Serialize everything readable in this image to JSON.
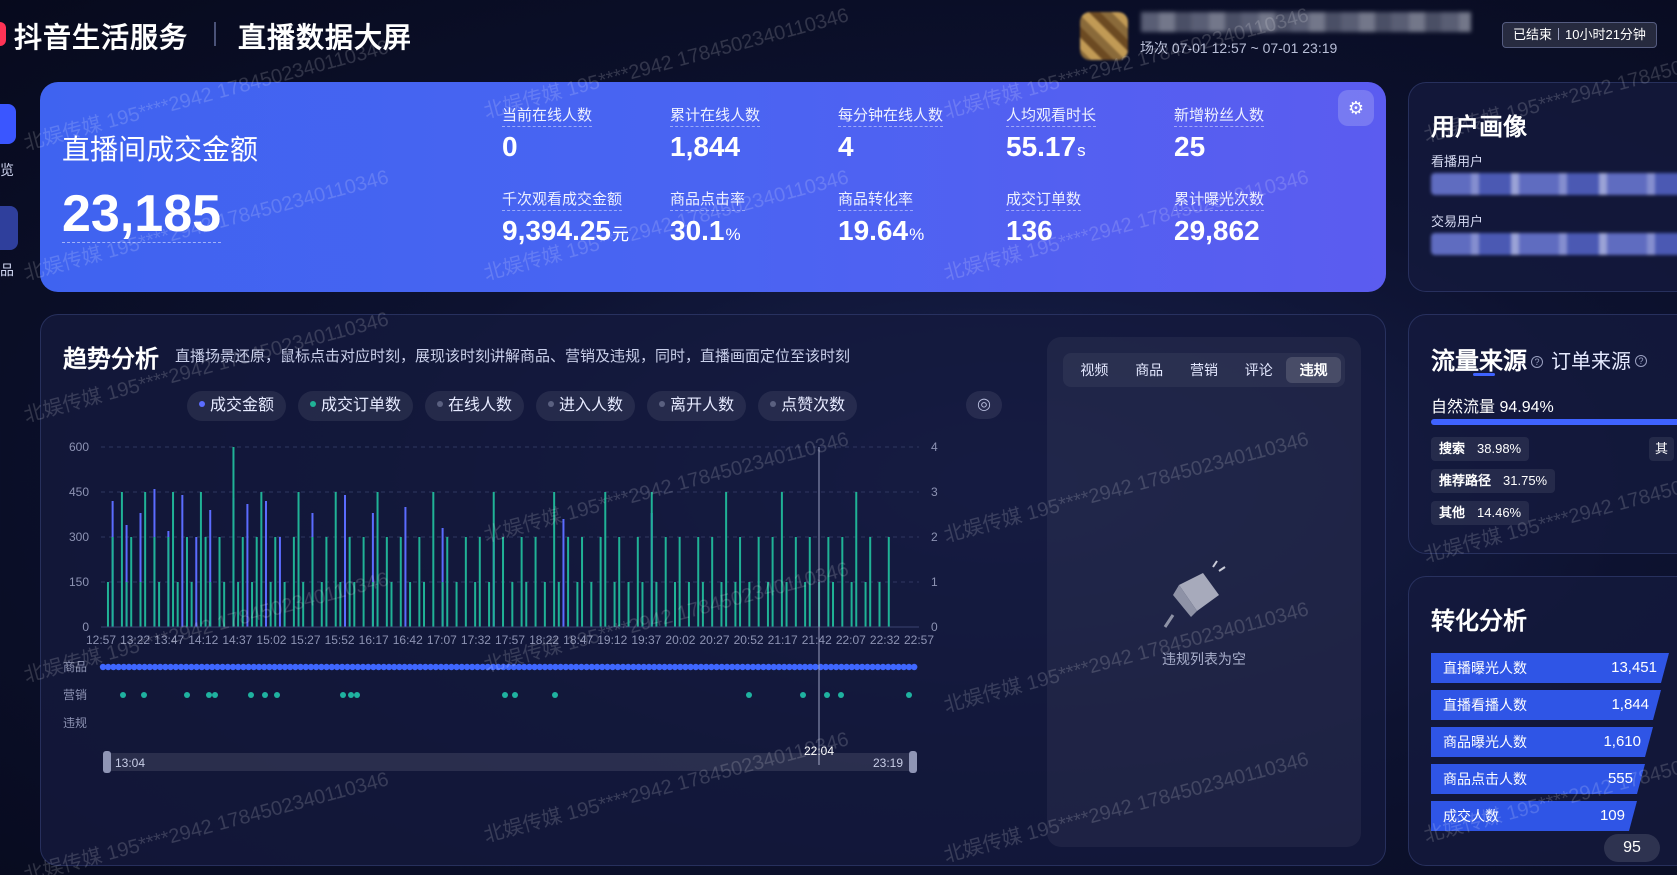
{
  "header": {
    "brand": "抖音生活服务",
    "screen_title": "直播数据大屏",
    "session": "场次 07-01 12:57 ~ 07-01 23:19",
    "status": "已结束",
    "duration": "10小时21分钟"
  },
  "left_nav": {
    "item1_label": "览",
    "item2_label": "品"
  },
  "kpi": {
    "title": "直播间成交金额",
    "value": "23,185",
    "metrics": [
      {
        "label": "当前在线人数",
        "value": "0",
        "unit": ""
      },
      {
        "label": "累计在线人数",
        "value": "1,844",
        "unit": ""
      },
      {
        "label": "每分钟在线人数",
        "value": "4",
        "unit": ""
      },
      {
        "label": "人均观看时长",
        "value": "55.17",
        "unit": "s"
      },
      {
        "label": "新增粉丝人数",
        "value": "25",
        "unit": ""
      },
      {
        "label": "千次观看成交金额",
        "value": "9,394.25",
        "unit": "元"
      },
      {
        "label": "商品点击率",
        "value": "30.1",
        "unit": "%"
      },
      {
        "label": "商品转化率",
        "value": "19.64",
        "unit": "%"
      },
      {
        "label": "成交订单数",
        "value": "136",
        "unit": ""
      },
      {
        "label": "累计曝光次数",
        "value": "29,862",
        "unit": ""
      }
    ]
  },
  "trend": {
    "title": "趋势分析",
    "subtitle": "直播场景还原，鼠标点击对应时刻，展现该时刻讲解商品、营销及违规，同时，直播画面定位至该时刻",
    "legend": [
      {
        "label": "成交金额",
        "color": "#5b6cff"
      },
      {
        "label": "成交订单数",
        "color": "#20b296"
      },
      {
        "label": "在线人数",
        "color": "#5a6080"
      },
      {
        "label": "进入人数",
        "color": "#5a6080"
      },
      {
        "label": "离开人数",
        "color": "#5a6080"
      },
      {
        "label": "点赞次数",
        "color": "#5a6080"
      }
    ],
    "track_labels": [
      "商品",
      "营销",
      "违规"
    ],
    "slider": {
      "start": "13:04",
      "end": "23:19",
      "marker": "22:04"
    }
  },
  "chart_data": {
    "type": "bar",
    "x_ticks": [
      "12:57",
      "13:22",
      "13:47",
      "14:12",
      "14:37",
      "15:02",
      "15:27",
      "15:52",
      "16:17",
      "16:42",
      "17:07",
      "17:32",
      "17:57",
      "18:22",
      "18:47",
      "19:12",
      "19:37",
      "20:02",
      "20:27",
      "20:52",
      "21:17",
      "21:42",
      "22:07",
      "22:32",
      "22:57"
    ],
    "y_left": {
      "ticks": [
        0,
        150,
        300,
        450,
        600
      ],
      "ylim": [
        0,
        600
      ]
    },
    "y_right": {
      "ticks": [
        0,
        1,
        2,
        3,
        4
      ],
      "ylim": [
        0,
        4
      ]
    },
    "grid": true,
    "series": [
      {
        "name": "成交金额",
        "color": "#5b6cff",
        "axis": "left",
        "values": [
          0,
          0,
          420,
          0,
          0,
          340,
          0,
          0,
          380,
          0,
          0,
          460,
          0,
          0,
          320,
          0,
          0,
          440,
          0,
          0,
          300,
          0,
          0,
          390,
          0,
          0,
          0,
          0,
          430,
          0,
          0,
          410,
          0,
          0,
          0,
          420,
          0,
          0,
          300,
          0,
          0,
          0,
          0,
          0,
          0,
          380,
          0,
          0,
          0,
          0,
          0,
          0,
          440,
          0,
          0,
          0,
          0,
          0,
          380,
          0,
          0,
          0,
          0,
          0,
          0,
          400,
          0,
          0,
          0,
          0,
          0,
          0,
          0,
          330,
          0,
          0,
          0,
          0,
          0,
          0,
          0,
          0,
          0,
          0,
          300,
          0,
          0,
          0,
          0,
          0,
          0,
          0,
          0,
          0,
          0,
          0,
          0,
          0,
          0,
          360,
          0,
          0,
          0,
          0,
          0,
          0,
          0,
          0,
          0,
          0,
          0,
          0,
          0,
          0,
          0,
          0,
          0,
          0,
          380,
          0,
          0,
          0,
          0,
          0,
          0,
          0,
          0,
          0,
          0,
          0,
          0,
          0,
          0,
          0,
          0,
          0,
          0,
          0,
          0,
          0,
          0,
          0,
          0,
          0,
          0,
          0,
          0,
          0,
          0,
          0,
          0,
          0,
          0,
          0,
          0,
          0,
          0,
          0,
          0,
          0,
          0,
          0,
          0,
          0,
          0,
          0,
          0,
          0,
          0,
          0,
          0,
          0,
          0,
          0,
          0,
          0
        ]
      },
      {
        "name": "成交订单数",
        "color": "#20b296",
        "axis": "right",
        "values": [
          0,
          1,
          2,
          0,
          3,
          1,
          2,
          0,
          1,
          3,
          0,
          2,
          1,
          0,
          2,
          3,
          1,
          0,
          2,
          1,
          0,
          3,
          2,
          1,
          0,
          2,
          1,
          0,
          4,
          1,
          2,
          0,
          1,
          2,
          3,
          0,
          1,
          2,
          0,
          1,
          0,
          2,
          3,
          1,
          0,
          2,
          0,
          1,
          2,
          0,
          3,
          1,
          0,
          2,
          1,
          0,
          2,
          0,
          1,
          3,
          0,
          2,
          1,
          0,
          2,
          0,
          1,
          0,
          2,
          1,
          0,
          3,
          0,
          1,
          2,
          0,
          1,
          0,
          2,
          0,
          1,
          2,
          0,
          1,
          3,
          0,
          2,
          0,
          1,
          0,
          2,
          1,
          0,
          2,
          0,
          1,
          0,
          3,
          1,
          0,
          2,
          0,
          1,
          2,
          0,
          1,
          0,
          2,
          3,
          0,
          1,
          2,
          0,
          1,
          0,
          2,
          1,
          0,
          3,
          1,
          0,
          2,
          0,
          1,
          2,
          0,
          1,
          0,
          2,
          1,
          0,
          2,
          0,
          1,
          3,
          0,
          1,
          2,
          0,
          1,
          0,
          2,
          0,
          1,
          2,
          0,
          3,
          1,
          0,
          2,
          0,
          1,
          2,
          0,
          1,
          0,
          2,
          1,
          0,
          2,
          0,
          1,
          3,
          0,
          1,
          2,
          0,
          1,
          0,
          2
        ]
      }
    ]
  },
  "violation": {
    "tabs": [
      "视频",
      "商品",
      "营销",
      "评论",
      "违规"
    ],
    "active_tab": 4,
    "empty_text": "违规列表为空"
  },
  "user_profile": {
    "title": "用户画像",
    "viewer_label": "看播用户",
    "buyer_label": "交易用户"
  },
  "traffic": {
    "tab1": "流量来源",
    "tab2": "订单来源",
    "natural_label": "自然流量 94.94%",
    "natural_share": 0.9494,
    "sources": [
      {
        "name": "搜索",
        "pct": "38.98%"
      },
      {
        "name": "推荐路径",
        "pct": "31.75%"
      },
      {
        "name": "其他",
        "pct": "14.46%"
      }
    ],
    "clipped_tag": "其"
  },
  "conversion": {
    "title": "转化分析",
    "rows": [
      {
        "label": "直播曝光人数",
        "value": "13,451"
      },
      {
        "label": "直播看播人数",
        "value": "1,844"
      },
      {
        "label": "商品曝光人数",
        "value": "1,610"
      },
      {
        "label": "商品点击人数",
        "value": "555"
      },
      {
        "label": "成交人数",
        "value": "109"
      }
    ]
  },
  "corner_badge": "95",
  "watermark": "北娱传媒 195****2942 17845023401103​46"
}
